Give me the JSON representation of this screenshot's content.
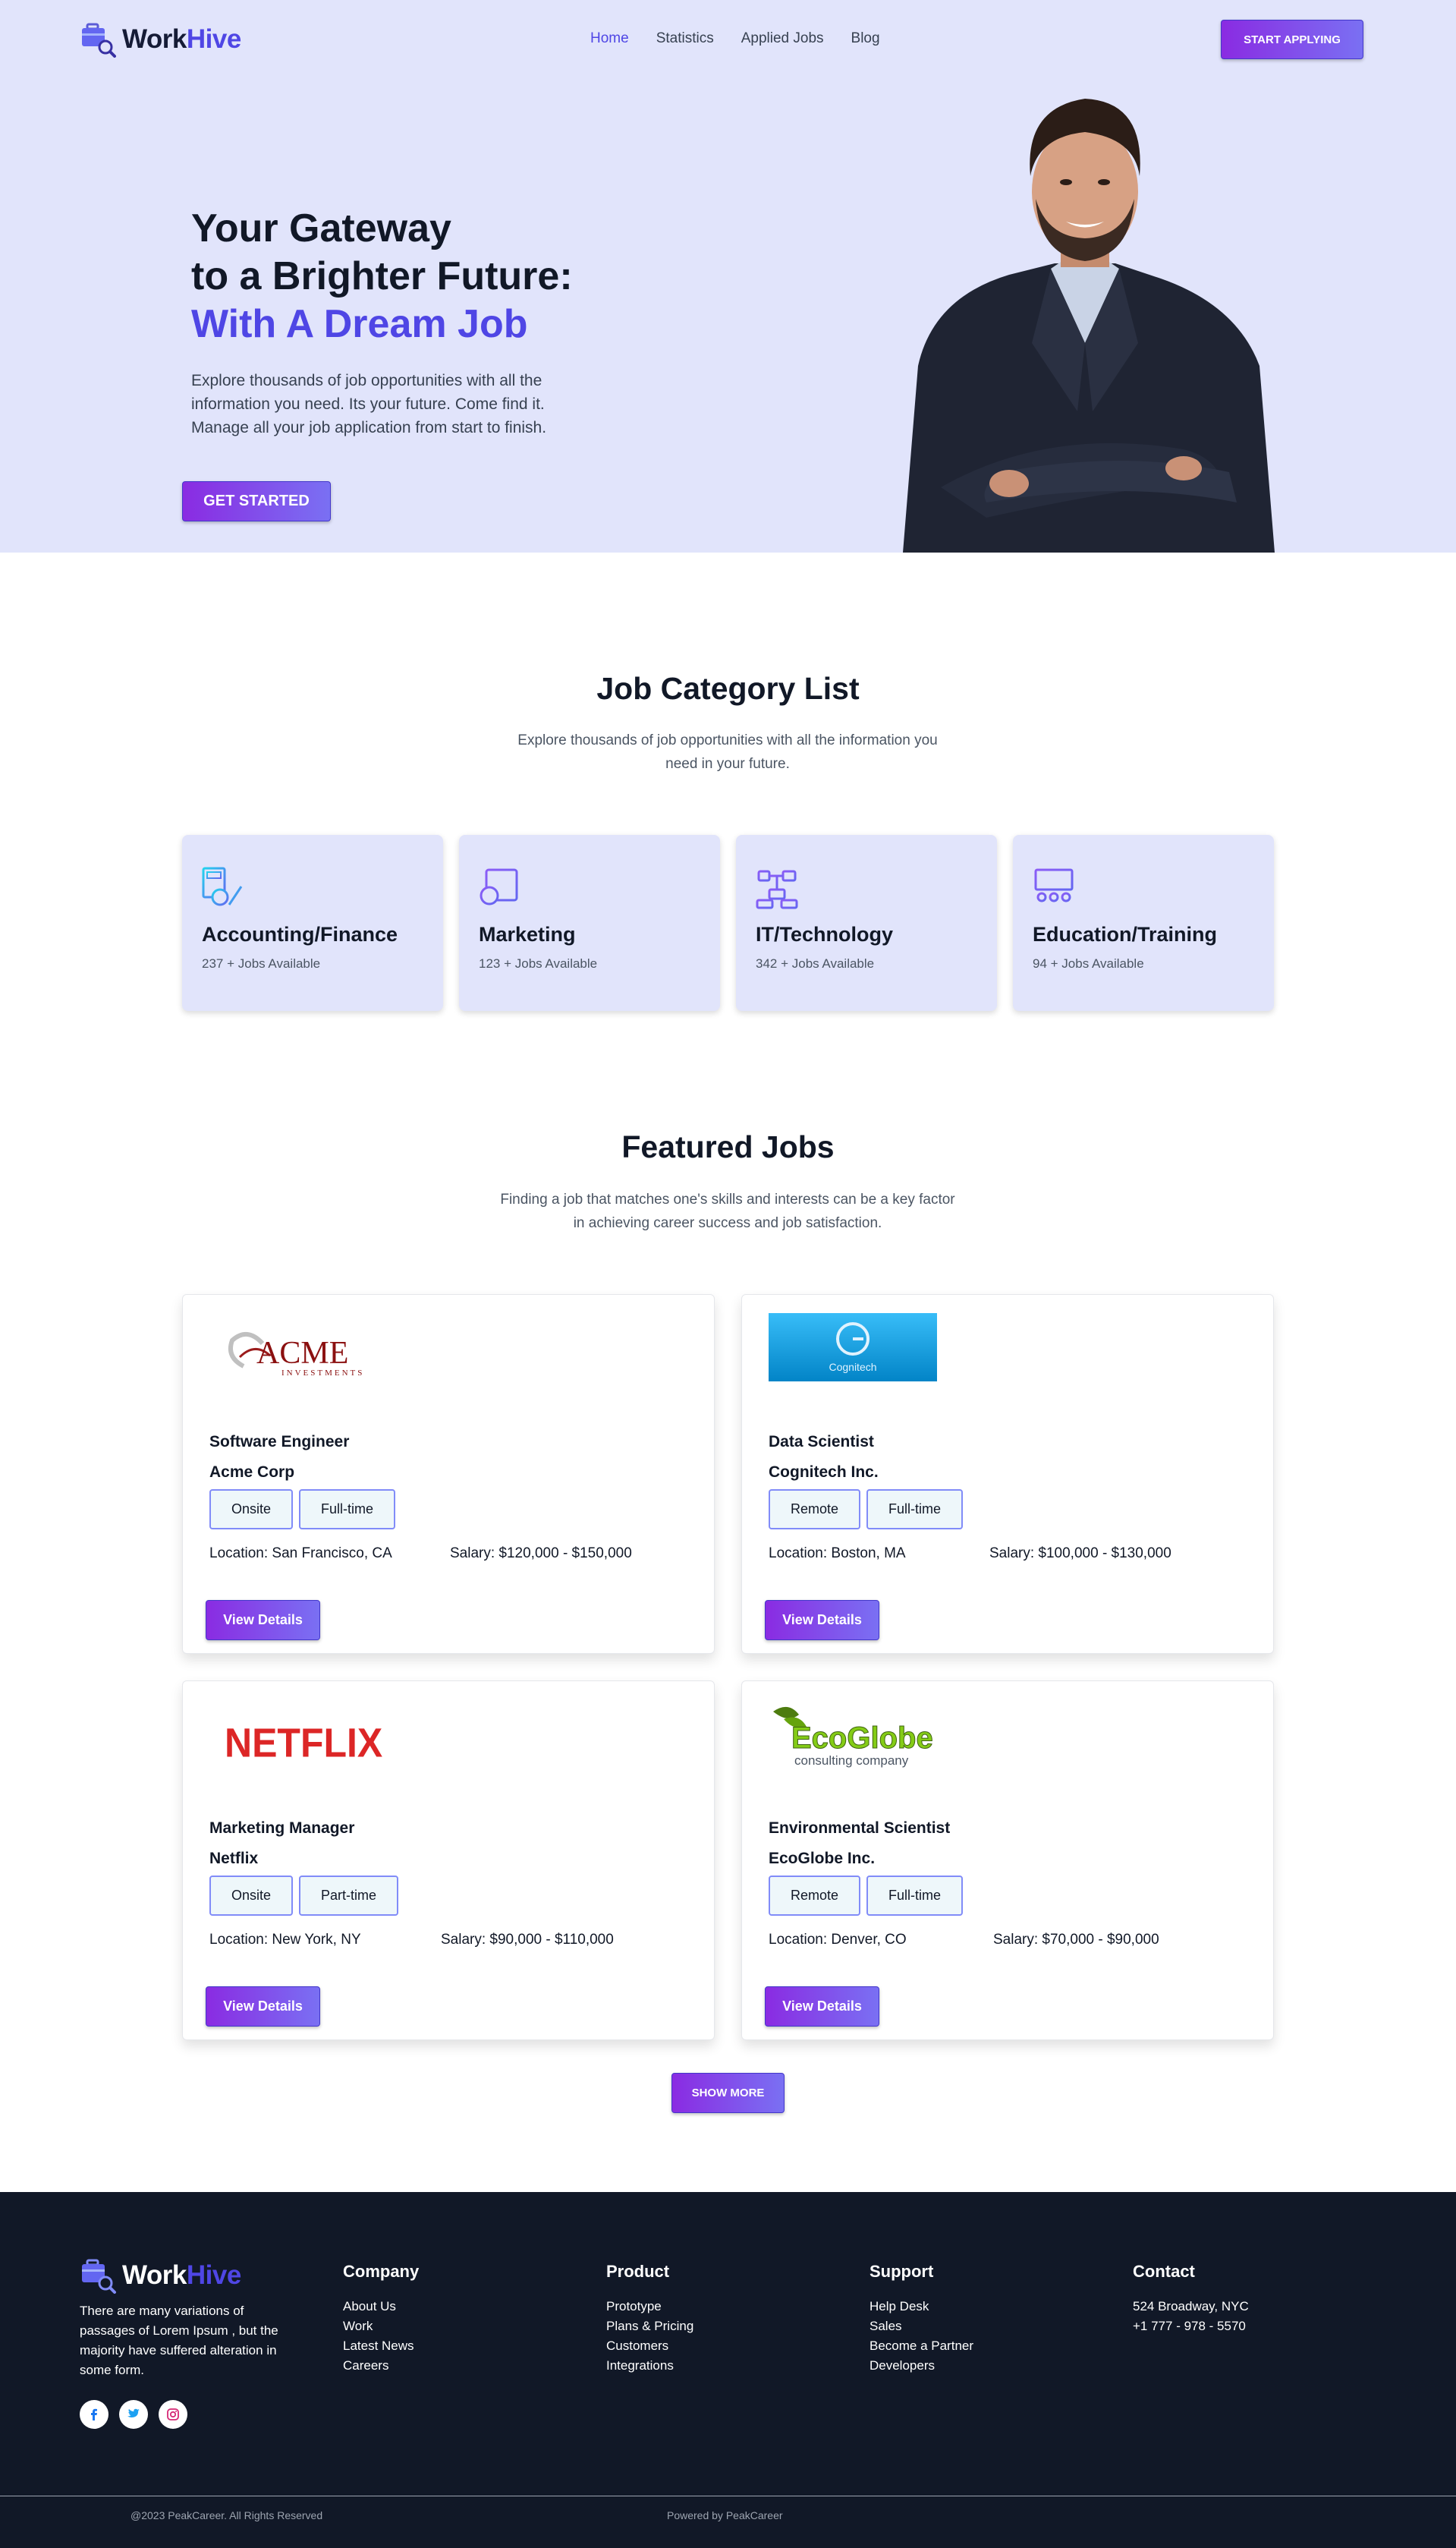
{
  "brand": {
    "work": "Work",
    "hive": "Hive"
  },
  "nav": {
    "items": [
      "Home",
      "Statistics",
      "Applied Jobs",
      "Blog"
    ],
    "active": "Home",
    "cta": "START APPLYING"
  },
  "hero": {
    "line1": "Your Gateway",
    "line2": "to a Brighter Future:",
    "line3": "With A Dream Job",
    "intro": "Explore thousands of job opportunities with all the information you need. Its your future. Come find it. Manage all your job application from start to finish.",
    "cta": "GET STARTED"
  },
  "categories": {
    "title": "Job Category List",
    "subtitle": "Explore thousands of job opportunities with all the information you need in your future.",
    "items": [
      {
        "name": "Accounting/Finance",
        "count": "237 + Jobs Available",
        "icon": "accounting-icon"
      },
      {
        "name": "Marketing",
        "count": "123 + Jobs Available",
        "icon": "marketing-icon"
      },
      {
        "name": "IT/Technology",
        "count": "342 + Jobs Available",
        "icon": "technology-icon"
      },
      {
        "name": "Education/Training",
        "count": "94 + Jobs Available",
        "icon": "education-icon"
      }
    ]
  },
  "featured": {
    "title": "Featured Jobs",
    "subtitle": "Finding a job that matches one's skills and interests can be a key factor in achieving career success and job satisfaction.",
    "details_label": "View Details",
    "show_more": "SHOW MORE",
    "jobs": [
      {
        "logo_text": "ACME",
        "logo_sub": "INVESTMENTS",
        "title": "Software Engineer",
        "company": "Acme Corp",
        "tags": [
          "Onsite",
          "Full-time"
        ],
        "location": "Location: San Francisco, CA",
        "salary": "Salary: $120,000 - $150,000"
      },
      {
        "logo_text": "Cognitech",
        "title": "Data Scientist",
        "company": "Cognitech Inc.",
        "tags": [
          "Remote",
          "Full-time"
        ],
        "location": "Location: Boston, MA",
        "salary": "Salary: $100,000 - $130,000"
      },
      {
        "logo_text": "NETFLIX",
        "title": "Marketing Manager",
        "company": "Netflix",
        "tags": [
          "Onsite",
          "Part-time"
        ],
        "location": "Location: New York, NY",
        "salary": "Salary: $90,000 - $110,000"
      },
      {
        "logo_text": "EcoGlobe",
        "logo_sub": "consulting company",
        "title": "Environmental Scientist",
        "company": "EcoGlobe Inc.",
        "tags": [
          "Remote",
          "Full-time"
        ],
        "location": "Location: Denver, CO",
        "salary": "Salary: $70,000 - $90,000"
      }
    ]
  },
  "footer": {
    "about": "There are many variations of passages of Lorem Ipsum , but the majority have suffered alteration in some form.",
    "columns": [
      {
        "heading": "Company",
        "links": [
          "About Us",
          "Work",
          "Latest News",
          "Careers"
        ]
      },
      {
        "heading": "Product",
        "links": [
          "Prototype",
          "Plans & Pricing",
          "Customers",
          "Integrations"
        ]
      },
      {
        "heading": "Support",
        "links": [
          "Help Desk",
          "Sales",
          "Become a Partner",
          "Developers"
        ]
      },
      {
        "heading": "Contact",
        "links": [
          "524 Broadway, NYC",
          "+1 777 - 978 - 5570"
        ]
      }
    ],
    "socials": [
      "facebook-icon",
      "twitter-icon",
      "instagram-icon"
    ],
    "copyright": "@2023 PeakCareer. All Rights Reserved",
    "powered": "Powered by PeakCareer"
  },
  "colors": {
    "accent": "#4f46e5",
    "hero_bg": "#e1e4fb",
    "footer_bg": "#111827",
    "button_start": "#8a2be2",
    "button_end": "#7a70f3"
  }
}
